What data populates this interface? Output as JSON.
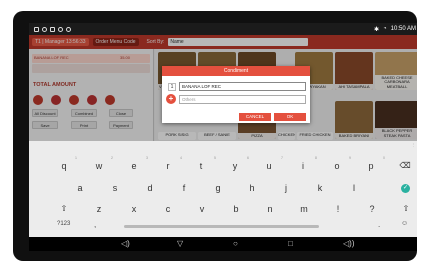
{
  "status_bar": {
    "time": "10:50 AM",
    "icons_left": [
      "app-icon",
      "notification-icon",
      "image-icon",
      "sync-icon",
      "sync-icon"
    ],
    "icons_right": [
      "bluetooth-icon",
      "wifi-icon"
    ]
  },
  "header": {
    "table_chip": "T1 | Manager",
    "timer": "13:56:33",
    "order_chip": "Order Menu Code",
    "sort_label": "Sort By:",
    "sort_value": "Name"
  },
  "left_panel": {
    "total_label": "TOTAL AMOUNT",
    "row1_text": "BANANA LOF REC",
    "row1_price": "35.00",
    "buttons": [
      "All Discount",
      "Combined",
      "Close",
      "Save",
      "Print",
      "Payment"
    ]
  },
  "grid": {
    "tiles": [
      "VEGETABLE SOUP",
      "CHOPSUEY",
      "WANTON",
      "WAWYAKAN",
      "AHI TASAMPALA",
      "BAKED CHEESE CARBONARA MEATBALL",
      "PIZZA",
      "CHICKEN",
      "FRIED CHICKEN",
      "PORK SISIG",
      "BEEF / SANIE",
      "BAKED BRIYANI",
      "BLACK PEPPER STEAK PASTA"
    ]
  },
  "dialog": {
    "title": "Condiment",
    "qty": "1",
    "condiment_value": "BANANA LOF REC",
    "others_placeholder": "Others",
    "cancel_label": "CANCEL",
    "ok_label": "OK"
  },
  "keyboard": {
    "row1": [
      "q",
      "w",
      "e",
      "r",
      "t",
      "y",
      "u",
      "i",
      "o",
      "p"
    ],
    "row1_nums": [
      "1",
      "2",
      "3",
      "4",
      "5",
      "6",
      "7",
      "8",
      "9",
      "0"
    ],
    "row2": [
      "a",
      "s",
      "d",
      "f",
      "g",
      "h",
      "j",
      "k",
      "l"
    ],
    "row3": [
      "z",
      "x",
      "c",
      "v",
      "b",
      "n",
      "m",
      "!",
      "?"
    ],
    "sym_label": "?123",
    "comma": ",",
    "period": "."
  },
  "colors": {
    "accent": "#e4503e",
    "header": "#c0392b",
    "enter": "#2ab1a0"
  }
}
